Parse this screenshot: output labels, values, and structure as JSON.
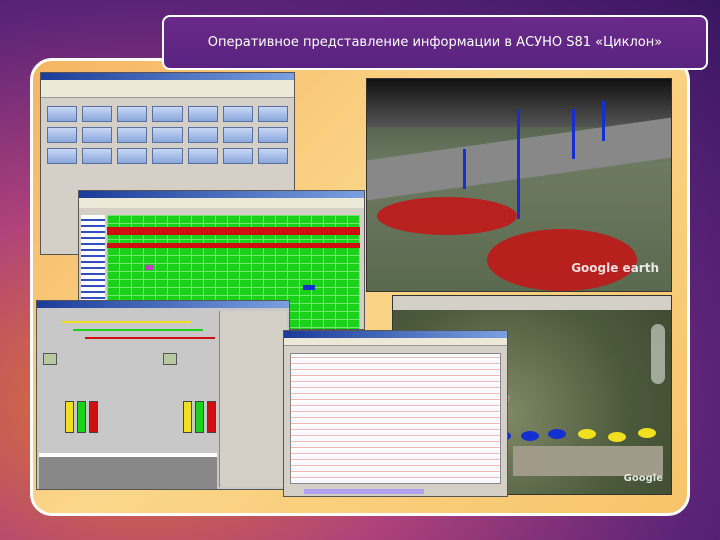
{
  "slide": {
    "title": "Оперативное представление информации в АСУНО S81 «Циклон»"
  },
  "earth_view": {
    "watermark": "Google earth"
  },
  "aerial_view": {
    "watermark": "Google"
  },
  "colors": {
    "accent": "#5a2380",
    "frame": "#ffffff",
    "status_red": "#c01818",
    "status_green": "#19d219",
    "status_yellow": "#f0e020",
    "status_blue": "#1530d0"
  }
}
